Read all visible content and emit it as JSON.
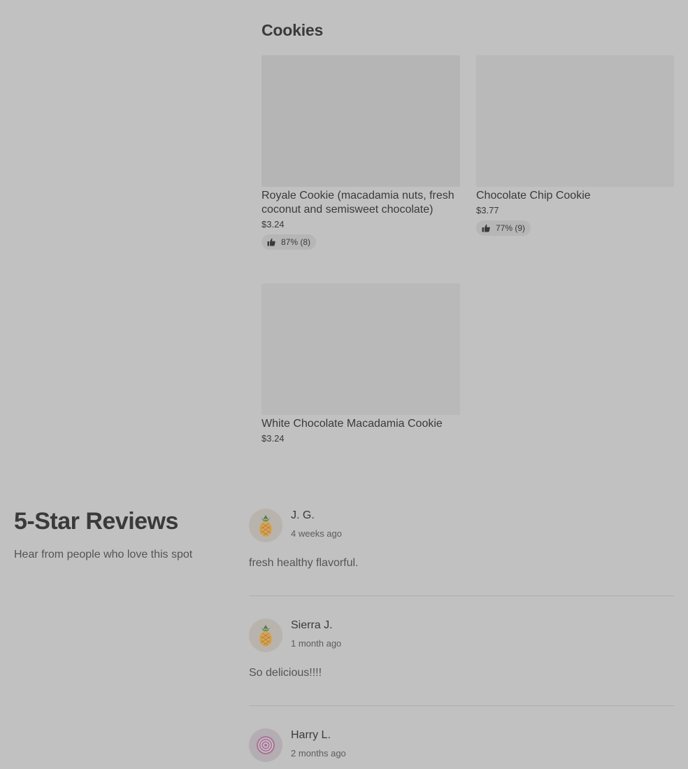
{
  "menu": {
    "section_title": "Cookies",
    "items": [
      {
        "name": "Royale Cookie (macadamia nuts, fresh coconut and semisweet chocolate)",
        "price": "$3.24",
        "rating": "87% (8)"
      },
      {
        "name": "Chocolate Chip Cookie",
        "price": "$3.77",
        "rating": "77% (9)"
      },
      {
        "name": "White Chocolate Macadamia Cookie",
        "price": "$3.24",
        "rating": ""
      }
    ]
  },
  "reviews": {
    "heading": "5-Star Reviews",
    "subheading": "Hear from people who love this spot",
    "items": [
      {
        "name": "J. G.",
        "date": "4 weeks ago",
        "text": "fresh healthy flavorful.",
        "avatar_icon": "pineapple-icon"
      },
      {
        "name": "Sierra J.",
        "date": "1 month ago",
        "text": "So delicious!!!!",
        "avatar_icon": "pineapple-icon"
      },
      {
        "name": "Harry L.",
        "date": "2 months ago",
        "text": "",
        "avatar_icon": "onion-icon"
      }
    ]
  },
  "colors": {
    "page_background": "#c1c1c1",
    "image_placeholder": "#b5b5b5",
    "rating_pill": "#b6b6b6"
  }
}
